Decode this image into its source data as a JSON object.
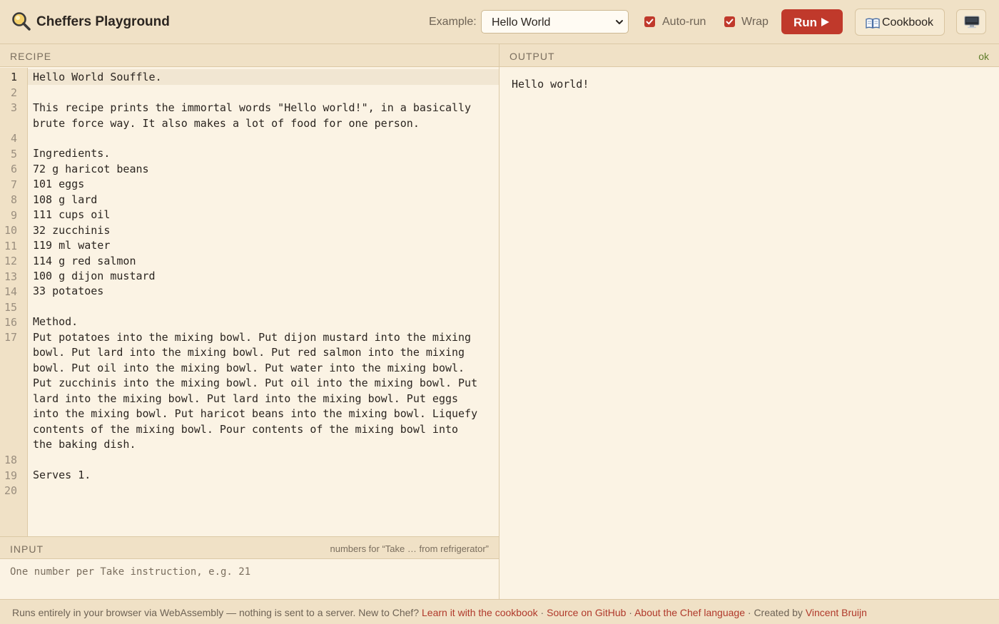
{
  "header": {
    "title": "Cheffers Playground",
    "example_label": "Example:",
    "example_selected": "Hello World",
    "autorun_label": "Auto-run",
    "autorun_checked": true,
    "wrap_label": "Wrap",
    "wrap_checked": true,
    "run_label": "Run",
    "cookbook_label": "Cookbook"
  },
  "recipe": {
    "panel_label": "RECIPE",
    "line_numbers": [
      "1",
      "2",
      "3",
      "4",
      "5",
      "6",
      "7",
      "8",
      "9",
      "10",
      "11",
      "12",
      "13",
      "14",
      "15",
      "16",
      "17",
      "18",
      "19",
      "20"
    ],
    "code": {
      "l1": "Hello World Souffle.",
      "l3a": "This recipe prints the immortal words \"Hello world!\", in a basically",
      "l3b": "brute force way. It also makes a lot of food for one person.",
      "l5": "Ingredients.",
      "l6": "72 g haricot beans",
      "l7": "101 eggs",
      "l8": "108 g lard",
      "l9": "111 cups oil",
      "l10": "32 zucchinis",
      "l11": "119 ml water",
      "l12": "114 g red salmon",
      "l13": "100 g dijon mustard",
      "l14": "33 potatoes",
      "l16": "Method.",
      "l17a": "Put potatoes into the mixing bowl. Put dijon mustard into the mixing",
      "l17b": "bowl. Put lard into the mixing bowl. Put red salmon into the mixing",
      "l17c": "bowl. Put oil into the mixing bowl. Put water into the mixing bowl.",
      "l17d": "Put zucchinis into the mixing bowl. Put oil into the mixing bowl. Put",
      "l17e": "lard into the mixing bowl. Put lard into the mixing bowl. Put eggs",
      "l17f": "into the mixing bowl. Put haricot beans into the mixing bowl. Liquefy",
      "l17g": "contents of the mixing bowl. Pour contents of the mixing bowl into",
      "l17h": "the baking dish.",
      "l19": "Serves 1."
    }
  },
  "input": {
    "panel_label": "INPUT",
    "hint": "numbers for “Take … from refrigerator”",
    "placeholder": "One number per Take instruction, e.g. 21"
  },
  "output": {
    "panel_label": "OUTPUT",
    "status": "ok",
    "text": "Hello world!"
  },
  "footer": {
    "text1": "Runs entirely in your browser via WebAssembly — nothing is sent to a server. New to Chef? ",
    "link_cookbook": "Learn it with the cookbook",
    "sep": " · ",
    "link_github": "Source on GitHub",
    "link_about": "About the Chef language",
    "created_by": "Created by ",
    "link_author": "Vincent Bruijn"
  },
  "icons": {
    "logo": "magnifier-icon",
    "cookbook": "book-icon",
    "theme": "monitor-icon",
    "run": "play-icon"
  },
  "colors": {
    "accent": "#c0392b",
    "header_bg": "#f0e1c6",
    "editor_bg": "#fbf3e4",
    "status_ok": "#5f7d2a"
  }
}
